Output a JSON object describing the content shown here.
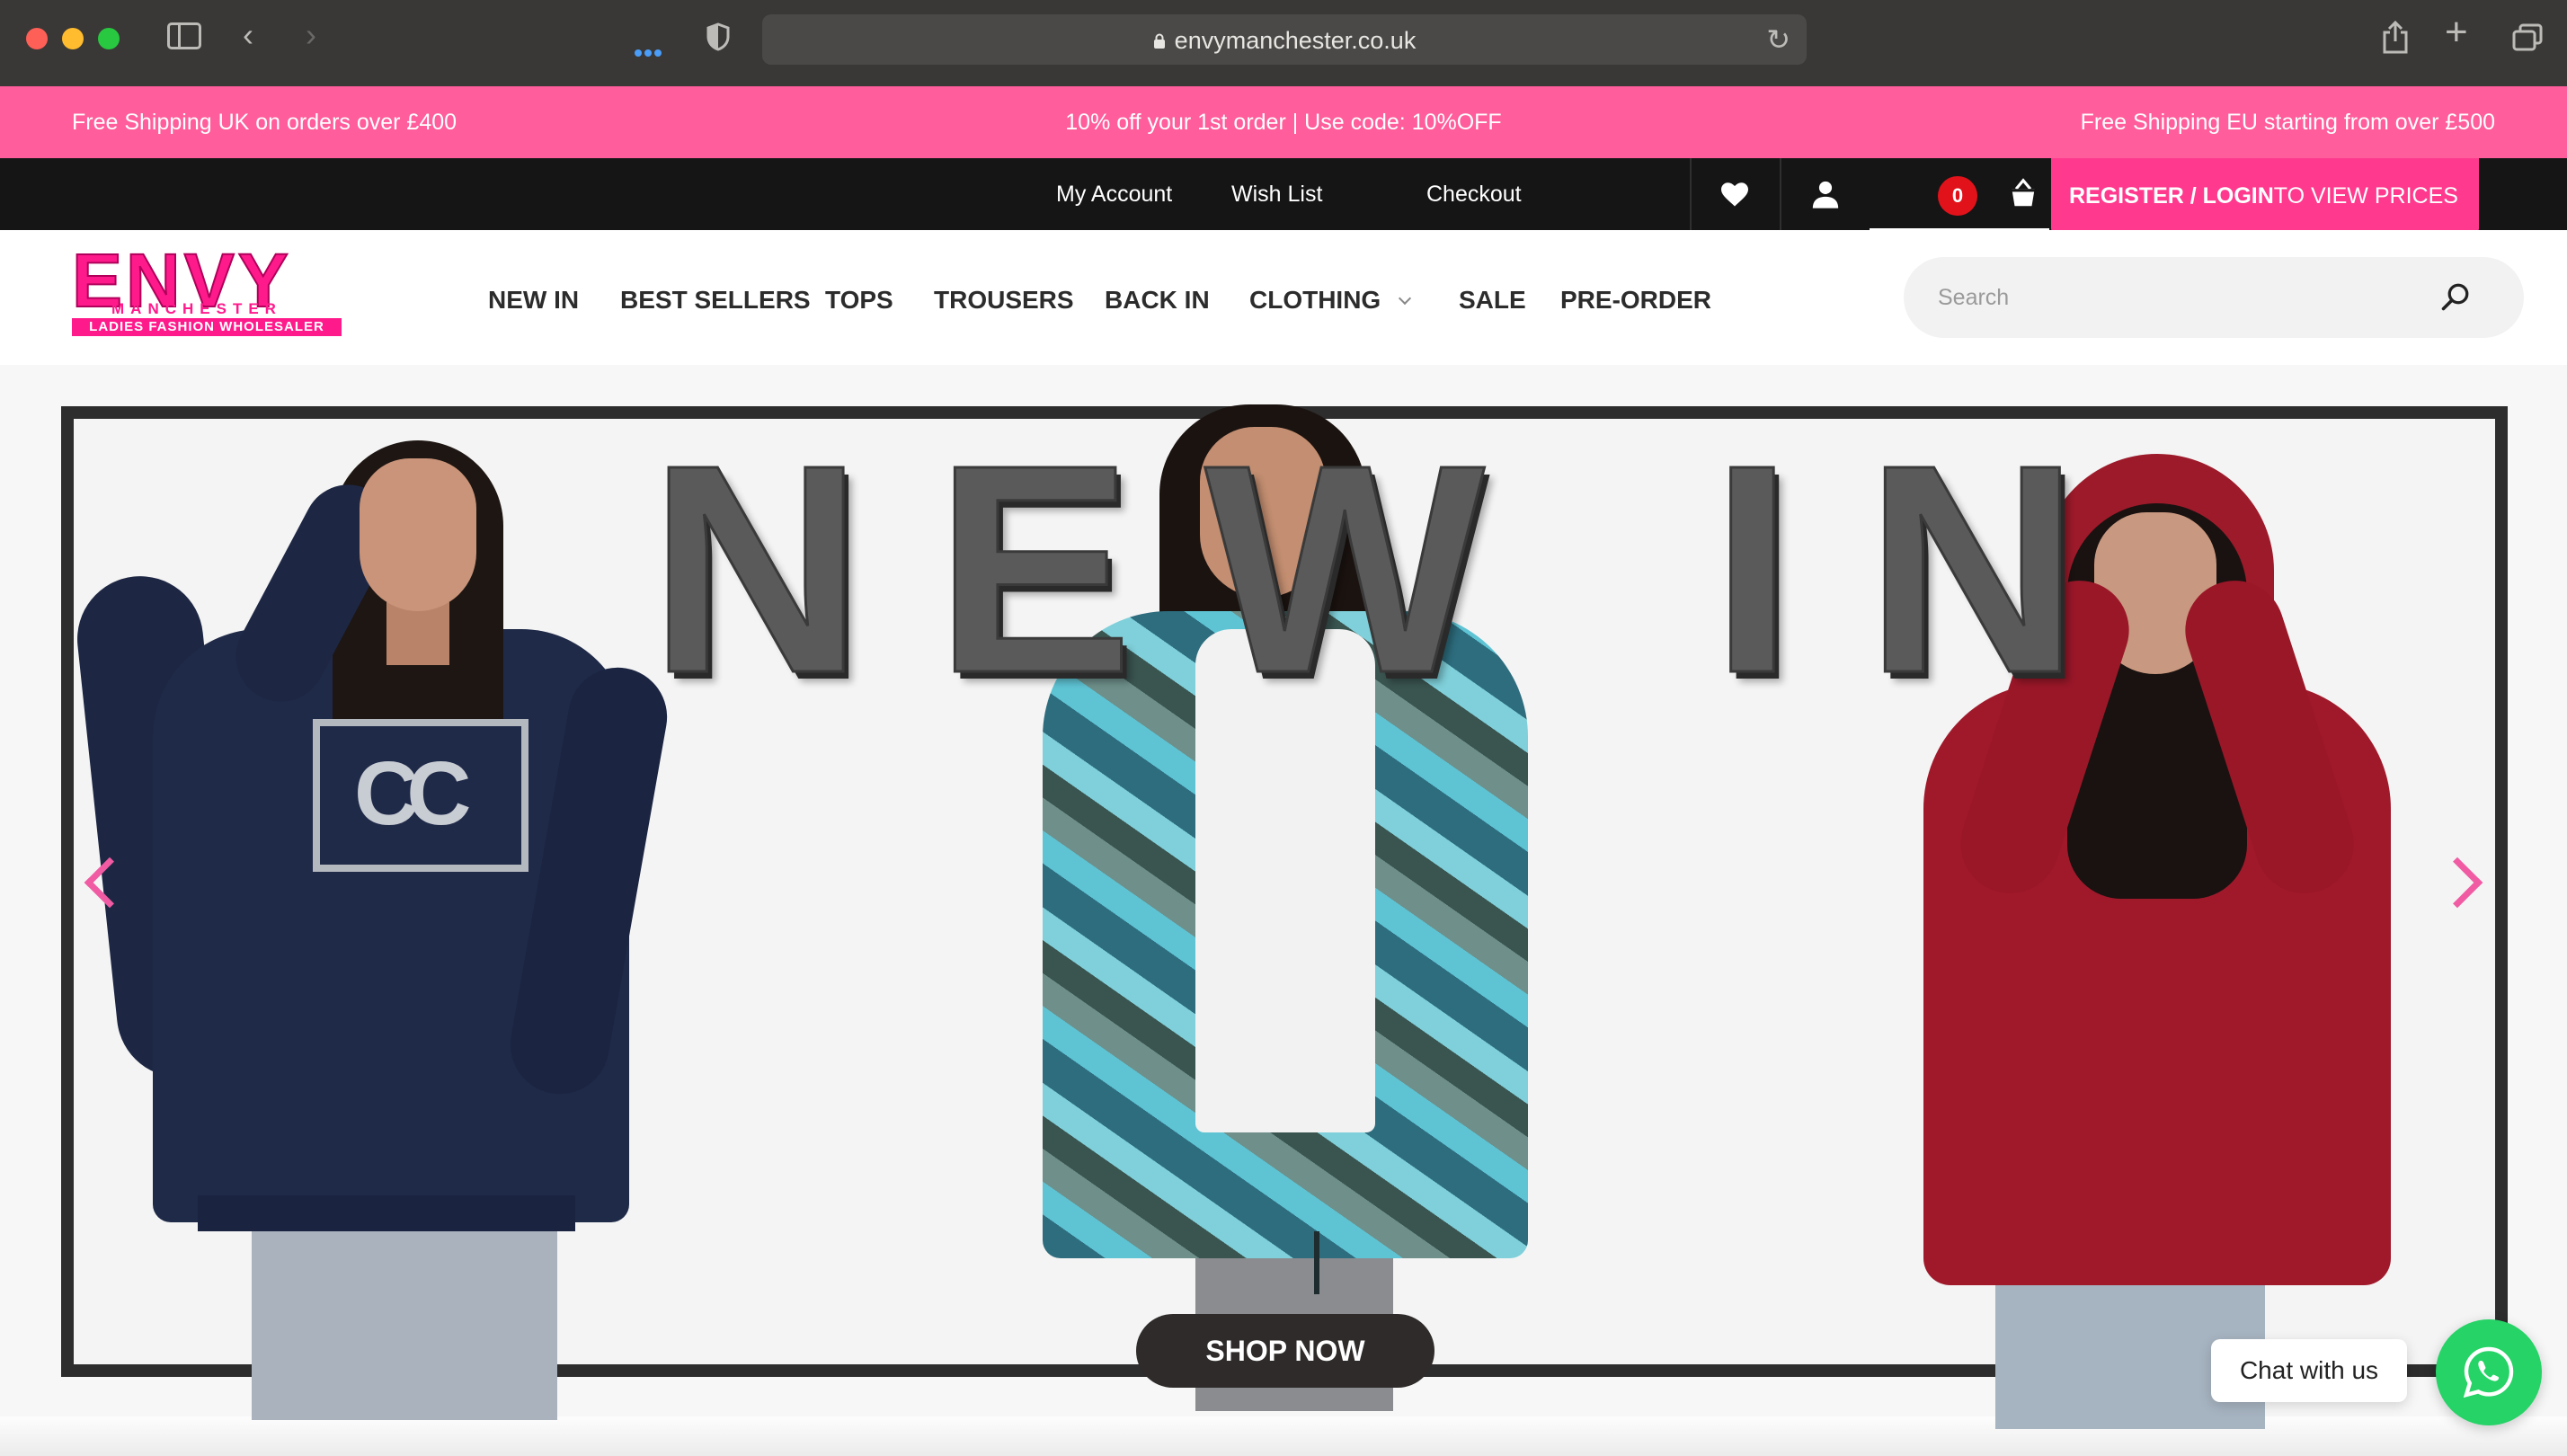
{
  "browser": {
    "url": "envymanchester.co.uk"
  },
  "promo": {
    "left": "Free Shipping UK on orders over £400",
    "center": "10% off your 1st order | Use code: 10%OFF",
    "right": "Free Shipping EU starting from over £500"
  },
  "account_bar": {
    "my_account": "My Account",
    "wish_list": "Wish List",
    "checkout": "Checkout",
    "cart_count": "0",
    "register_bold": "REGISTER / LOGIN",
    "register_rest": "TO VIEW PRICES"
  },
  "logo": {
    "main": "ENVY",
    "sub": "MANCHESTER",
    "tagline": "LADIES FASHION WHOLESALER"
  },
  "nav": {
    "items": [
      "NEW IN",
      "BEST SELLERS",
      "TOPS",
      "TROUSERS",
      "BACK IN",
      "CLOTHING",
      "SALE",
      "PRE-ORDER"
    ]
  },
  "search": {
    "placeholder": "Search"
  },
  "hero": {
    "headline": "NEW IN",
    "cta": "SHOP NOW"
  },
  "chat": {
    "label": "Chat with us"
  },
  "colors": {
    "promo_bg": "#ff5d9b",
    "brand_pink": "#ff1a8c",
    "register_bg": "#ff3a8e",
    "whatsapp": "#25d366"
  }
}
